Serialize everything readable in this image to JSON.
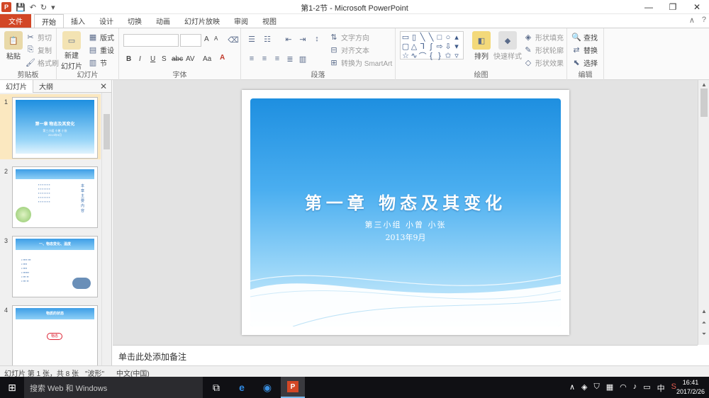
{
  "window": {
    "title": "第1-2节 - Microsoft PowerPoint",
    "controls": {
      "minimize": "—",
      "restore": "❐",
      "close": "✕"
    }
  },
  "tabs": [
    {
      "label": "文件",
      "active": false,
      "file": true
    },
    {
      "label": "开始",
      "active": true
    },
    {
      "label": "插入"
    },
    {
      "label": "设计"
    },
    {
      "label": "切换"
    },
    {
      "label": "动画"
    },
    {
      "label": "幻灯片放映"
    },
    {
      "label": "审阅"
    },
    {
      "label": "视图"
    }
  ],
  "ribbon": {
    "clipboard": {
      "label": "剪贴板",
      "paste": "粘贴",
      "cut": "剪切",
      "copy": "复制",
      "format_painter": "格式刷"
    },
    "slides": {
      "label": "幻灯片",
      "new_slide": "新建",
      "new_slide_2": "幻灯片",
      "layout": "版式",
      "reset": "重设",
      "section": "节"
    },
    "font": {
      "label": "字体",
      "bold": "B",
      "italic": "I",
      "underline": "U",
      "shadow": "S",
      "strike": "abc",
      "spacing": "AV",
      "case": "Aa",
      "grow": "A",
      "shrink": "A"
    },
    "paragraph": {
      "label": "段落",
      "text_direction": "文字方向",
      "align_text": "对齐文本",
      "convert_smartart": "转换为 SmartArt"
    },
    "drawing": {
      "label": "绘图",
      "arrange": "排列",
      "quick_styles": "快速样式",
      "shape_fill": "形状填充",
      "shape_outline": "形状轮廓",
      "shape_effects": "形状效果"
    },
    "editing": {
      "label": "编辑",
      "find": "查找",
      "replace": "替换",
      "select": "选择"
    }
  },
  "left_panel": {
    "tab_slides": "幻灯片",
    "tab_outline": "大纲",
    "close": "✕",
    "thumbnails": [
      {
        "num": "1",
        "title": "第一章 物态及其变化",
        "sub": "第三小组 小曾 小张",
        "sub2": "2013年9月"
      },
      {
        "num": "2",
        "title": "本章主要内容"
      },
      {
        "num": "3",
        "title": "一、物态变化、温度"
      },
      {
        "num": "4",
        "title": "物质的状态",
        "badge": "物态"
      }
    ]
  },
  "slide": {
    "title": "第一章  物态及其变化",
    "subtitle1": "第三小组 小曾 小张",
    "subtitle2": "2013年9月"
  },
  "notes": {
    "placeholder": "单击此处添加备注"
  },
  "status": {
    "slide_info": "幻灯片 第 1 张，共 8 张",
    "theme": "\"波形\"",
    "language": "中文(中国)"
  },
  "taskbar": {
    "search_placeholder": "搜索 Web 和 Windows",
    "tray_lang": "中",
    "time": "16:41",
    "date": "2017/2/26"
  },
  "colors": {
    "accent": "#d24726",
    "slide_sky": "#2f9ae6"
  }
}
